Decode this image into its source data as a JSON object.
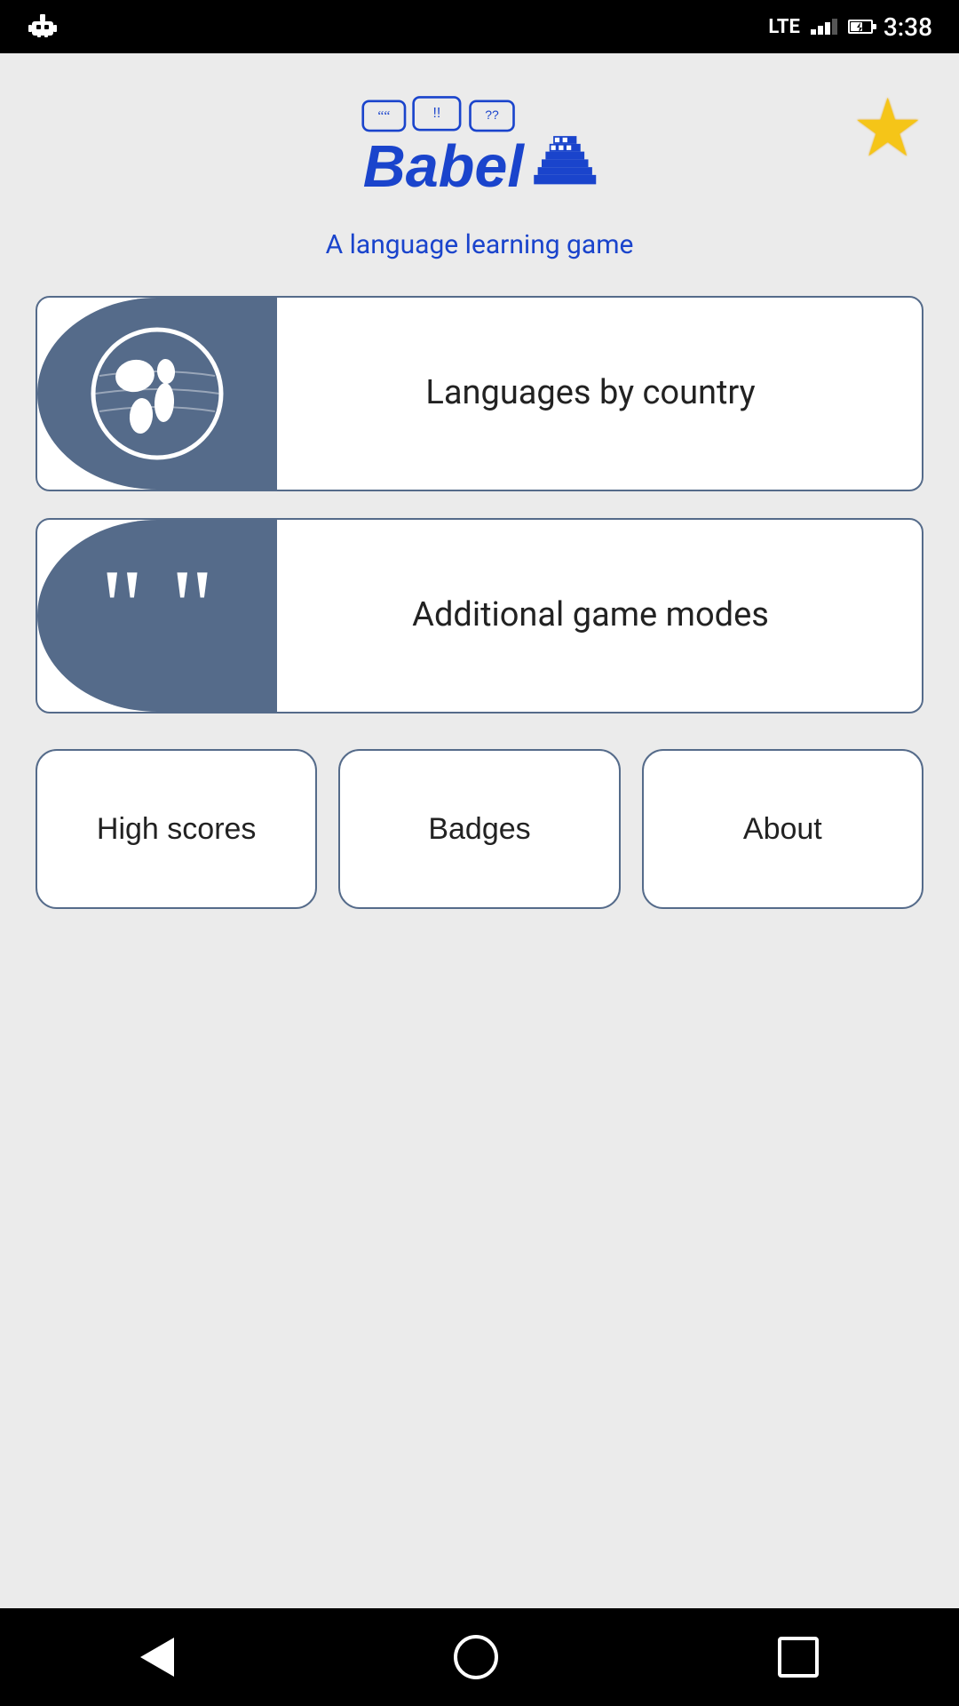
{
  "statusBar": {
    "time": "3:38",
    "lte": "LTE"
  },
  "header": {
    "logoText": "BabelTower",
    "subtitle": "A language learning game",
    "starLabel": "Favorites"
  },
  "buttons": {
    "languagesByCountry": "Languages by\ncountry",
    "additionalGameModes": "Additional game modes",
    "highScores": "High scores",
    "badges": "Badges",
    "about": "About"
  },
  "nav": {
    "back": "back",
    "home": "home",
    "recents": "recents"
  }
}
